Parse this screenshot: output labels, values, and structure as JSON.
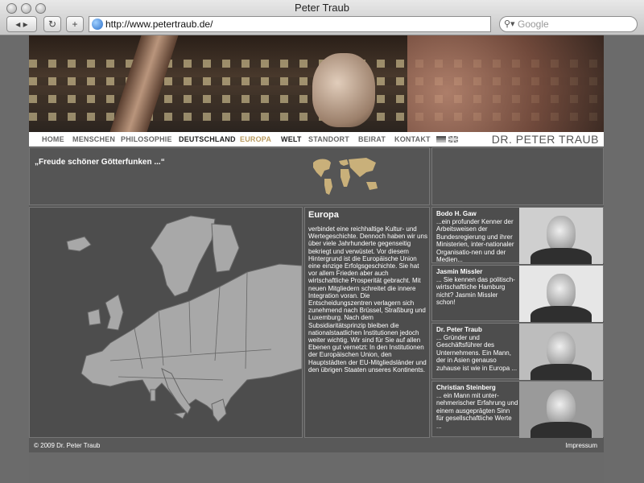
{
  "browser": {
    "window_title": "Peter Traub",
    "url": "http://www.petertraub.de/",
    "search_placeholder": "Google",
    "back_icon": "back-arrow-icon",
    "forward_icon": "forward-arrow-icon",
    "reload_glyph": "↻",
    "add_glyph": "+"
  },
  "nav": {
    "items": [
      "HOME",
      "MENSCHEN",
      "PHILOSOPHIE",
      "DEUTSCHLAND",
      "EUROPA",
      "WELT",
      "STANDORT",
      "BEIRAT",
      "KONTAKT"
    ],
    "active": "EUROPA",
    "active_color": "#b99a5e",
    "brand": "DR. PETER TRAUB"
  },
  "quote": "„Freude schöner Götterfunken ...“",
  "europa": {
    "title": "Europa",
    "text": "verbindet eine reichhaltige Kultur- und Wertegeschichte. Dennoch haben wir uns über viele Jahrhunderte gegenseitig bekriegt und verwüstet. Vor diesem Hintergrund ist die Europäische Union eine einzige Erfolgsgeschichte. Sie hat vor allem Frieden aber auch wirtschaftliche Prosperität gebracht. Mit neuen Mitgliedern schreitet die innere Integration voran. Die Entscheidungszentren verlagern sich zunehmend nach Brüssel, Straßburg und Luxemburg. Nach dem Subsidiaritätsprinzip bleiben die nationalstaatlichen Institutionen jedoch weiter wichtig. Wir sind für Sie auf allen Ebenen gut vernetzt: In den Institutionen der Europäischen Union, den Hauptstädten der EU-Mitgliedsländer und den übrigen Staaten unseres Kontinents."
  },
  "people": [
    {
      "name": "Bodo H. Gaw",
      "text": "...ein profunder Kenner der Arbeitsweisen der Bundesregierung und ihrer Ministerien, inter-nationaler Organisatio-nen und der Medien..."
    },
    {
      "name": "Jasmin Missler",
      "text": "... Sie kennen das politisch-wirtschaftliche Hamburg nicht? Jasmin Missler schon!"
    },
    {
      "name": "Dr. Peter Traub",
      "text": "... Gründer und Geschäftsführer des Unternehmens. Ein Mann, der in Asien genauso zuhause ist wie in Europa ..."
    },
    {
      "name": "Christian Steinberg",
      "text": "... ein Mann mit unter-nehmerischer Erfahrung und einem ausgeprägten Sinn für gesellschaftliche Werte ..."
    }
  ],
  "footer": {
    "copyright": "© 2009 Dr. Peter Traub",
    "impressum": "Impressum"
  },
  "colors": {
    "map_land": "#a8a8a8",
    "worldmap_land": "#c9b07a"
  }
}
